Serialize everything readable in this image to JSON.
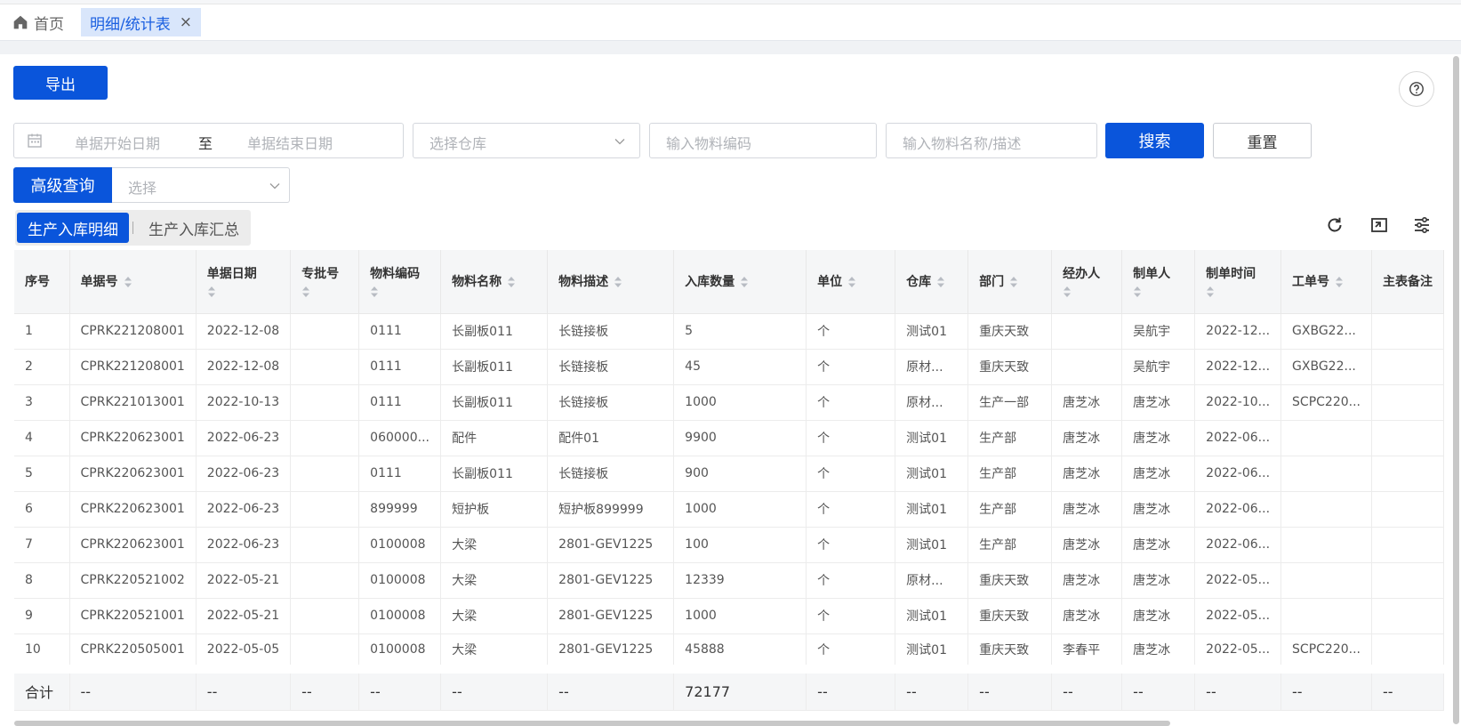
{
  "tabs": {
    "home": "首页",
    "active": "明细/统计表",
    "close": "×"
  },
  "toolbar": {
    "export": "导出"
  },
  "filters": {
    "date_start_placeholder": "单据开始日期",
    "date_separator": "至",
    "date_end_placeholder": "单据结束日期",
    "warehouse_placeholder": "选择仓库",
    "material_code_placeholder": "输入物料编码",
    "material_name_placeholder": "输入物料名称/描述",
    "search": "搜索",
    "reset": "重置",
    "advanced": "高级查询",
    "advanced_placeholder": "选择"
  },
  "views": {
    "detail": "生产入库明细",
    "summary": "生产入库汇总"
  },
  "icons": {
    "home": "home-icon",
    "help": "help-icon",
    "calendar": "calendar-icon",
    "refresh": "refresh-icon",
    "fullscreen": "fullscreen-icon",
    "settings": "column-settings-icon"
  },
  "colors": {
    "primary": "#0a55db",
    "tab_active_bg": "#d9e6fb",
    "header_bg": "#f5f6f7"
  },
  "table": {
    "columns": [
      {
        "label": "序号",
        "sortable": false,
        "wrap": false
      },
      {
        "label": "单据号",
        "sortable": true,
        "wrap": false
      },
      {
        "label": "单据日期",
        "sortable": true,
        "wrap": true
      },
      {
        "label": "专批号",
        "sortable": true,
        "wrap": true
      },
      {
        "label": "物料编码",
        "sortable": true,
        "wrap": true
      },
      {
        "label": "物料名称",
        "sortable": true,
        "wrap": false
      },
      {
        "label": "物料描述",
        "sortable": true,
        "wrap": false
      },
      {
        "label": "入库数量",
        "sortable": true,
        "wrap": false
      },
      {
        "label": "单位",
        "sortable": true,
        "wrap": false
      },
      {
        "label": "仓库",
        "sortable": true,
        "wrap": false
      },
      {
        "label": "部门",
        "sortable": true,
        "wrap": false
      },
      {
        "label": "经办人",
        "sortable": true,
        "wrap": true
      },
      {
        "label": "制单人",
        "sortable": true,
        "wrap": true
      },
      {
        "label": "制单时间",
        "sortable": true,
        "wrap": true
      },
      {
        "label": "工单号",
        "sortable": true,
        "wrap": false
      },
      {
        "label": "主表备注",
        "sortable": false,
        "wrap": false
      }
    ],
    "rows": [
      [
        "1",
        "CPRK221208001",
        "2022-12-08",
        "",
        "0111",
        "长副板011",
        "长链接板",
        "5",
        "个",
        "测试01",
        "重庆天致",
        "",
        "吴航宇",
        "2022-12...",
        "GXBG22...",
        ""
      ],
      [
        "2",
        "CPRK221208001",
        "2022-12-08",
        "",
        "0111",
        "长副板011",
        "长链接板",
        "45",
        "个",
        "原材...",
        "重庆天致",
        "",
        "吴航宇",
        "2022-12...",
        "GXBG22...",
        ""
      ],
      [
        "3",
        "CPRK221013001",
        "2022-10-13",
        "",
        "0111",
        "长副板011",
        "长链接板",
        "1000",
        "个",
        "原材...",
        "生产一部",
        "唐芝冰",
        "唐芝冰",
        "2022-10...",
        "SCPC220...",
        ""
      ],
      [
        "4",
        "CPRK220623001",
        "2022-06-23",
        "",
        "060000...",
        "配件",
        "配件01",
        "9900",
        "个",
        "测试01",
        "生产部",
        "唐芝冰",
        "唐芝冰",
        "2022-06...",
        "",
        ""
      ],
      [
        "5",
        "CPRK220623001",
        "2022-06-23",
        "",
        "0111",
        "长副板011",
        "长链接板",
        "900",
        "个",
        "测试01",
        "生产部",
        "唐芝冰",
        "唐芝冰",
        "2022-06...",
        "",
        ""
      ],
      [
        "6",
        "CPRK220623001",
        "2022-06-23",
        "",
        "899999",
        "短护板",
        "短护板899999",
        "1000",
        "个",
        "测试01",
        "生产部",
        "唐芝冰",
        "唐芝冰",
        "2022-06...",
        "",
        ""
      ],
      [
        "7",
        "CPRK220623001",
        "2022-06-23",
        "",
        "0100008",
        "大梁",
        "2801-GEV1225",
        "100",
        "个",
        "测试01",
        "生产部",
        "唐芝冰",
        "唐芝冰",
        "2022-06...",
        "",
        ""
      ],
      [
        "8",
        "CPRK220521002",
        "2022-05-21",
        "",
        "0100008",
        "大梁",
        "2801-GEV1225",
        "12339",
        "个",
        "原材...",
        "重庆天致",
        "唐芝冰",
        "唐芝冰",
        "2022-05...",
        "",
        ""
      ],
      [
        "9",
        "CPRK220521001",
        "2022-05-21",
        "",
        "0100008",
        "大梁",
        "2801-GEV1225",
        "1000",
        "个",
        "测试01",
        "重庆天致",
        "唐芝冰",
        "唐芝冰",
        "2022-05...",
        "",
        ""
      ],
      [
        "10",
        "CPRK220505001",
        "2022-05-05",
        "",
        "0100008",
        "大梁",
        "2801-GEV1225",
        "45888",
        "个",
        "测试01",
        "重庆天致",
        "李春平",
        "唐芝冰",
        "2022-05...",
        "SCPC220...",
        ""
      ]
    ],
    "summary": [
      "合计",
      "--",
      "--",
      "--",
      "--",
      "--",
      "--",
      "72177",
      "--",
      "--",
      "--",
      "--",
      "--",
      "--",
      "--",
      "--"
    ]
  }
}
